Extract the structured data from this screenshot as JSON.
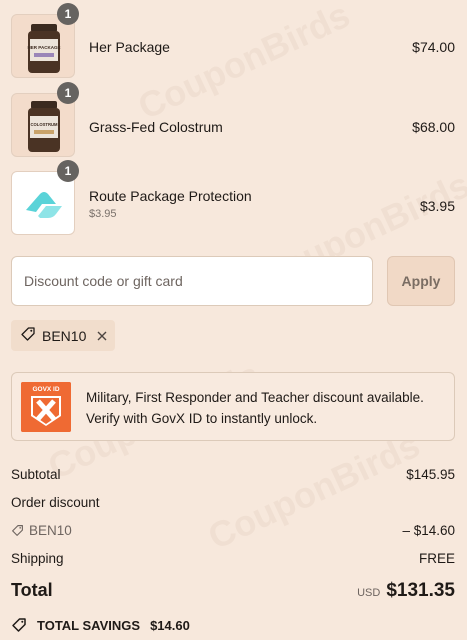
{
  "items": [
    {
      "name": "Her Package",
      "price": "$74.00",
      "qty": "1",
      "subtitle": "",
      "thumb_label": "HER PACKAGE"
    },
    {
      "name": "Grass-Fed Colostrum",
      "price": "$68.00",
      "qty": "1",
      "subtitle": "",
      "thumb_label": "COLOSTRUM"
    },
    {
      "name": "Route Package Protection",
      "price": "$3.95",
      "qty": "1",
      "subtitle": "$3.95"
    }
  ],
  "discount": {
    "placeholder": "Discount code or gift card",
    "apply_label": "Apply",
    "applied_code": "BEN10"
  },
  "govx": {
    "logo_text": "GOVX ID",
    "message": "Military, First Responder and Teacher discount available. Verify with GovX ID to instantly unlock."
  },
  "summary": {
    "subtotal_label": "Subtotal",
    "subtotal_value": "$145.95",
    "order_discount_label": "Order discount",
    "discount_code": "BEN10",
    "discount_value": "– $14.60",
    "shipping_label": "Shipping",
    "shipping_value": "FREE",
    "total_label": "Total",
    "currency": "USD",
    "total_value": "$131.35",
    "savings_label": "TOTAL SAVINGS",
    "savings_value": "$14.60"
  },
  "colors": {
    "background": "#f7e8dc",
    "badge": "#666360",
    "govx_orange": "#ef6a33",
    "route_teal": "#5ad3d8"
  }
}
